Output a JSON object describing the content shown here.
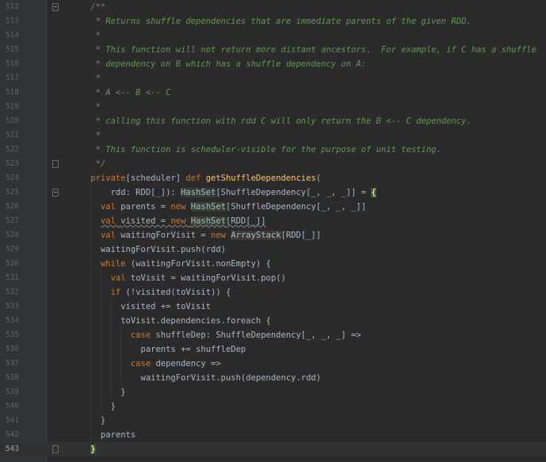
{
  "editor": {
    "lines": [
      {
        "num": "512",
        "fold": "open",
        "tokens": [
          {
            "t": "    /**",
            "c": "comment"
          }
        ]
      },
      {
        "num": "513",
        "tokens": [
          {
            "t": "     * Returns shuffle dependencies that are immediate parents of the given RDD.",
            "c": "comment"
          }
        ]
      },
      {
        "num": "514",
        "tokens": [
          {
            "t": "     *",
            "c": "comment"
          }
        ]
      },
      {
        "num": "515",
        "tokens": [
          {
            "t": "     * This function will not return more distant ancestors.  For example, if C has a shuffle",
            "c": "comment"
          }
        ]
      },
      {
        "num": "516",
        "tokens": [
          {
            "t": "     * dependency on B which has a shuffle dependency on A:",
            "c": "comment"
          }
        ]
      },
      {
        "num": "517",
        "tokens": [
          {
            "t": "     *",
            "c": "comment"
          }
        ]
      },
      {
        "num": "518",
        "tokens": [
          {
            "t": "     * A <-- B <-- C",
            "c": "comment"
          }
        ]
      },
      {
        "num": "519",
        "tokens": [
          {
            "t": "     *",
            "c": "comment"
          }
        ]
      },
      {
        "num": "520",
        "tokens": [
          {
            "t": "     * calling this function with rdd C will only return the B <-- C dependency.",
            "c": "comment"
          }
        ]
      },
      {
        "num": "521",
        "tokens": [
          {
            "t": "     *",
            "c": "comment"
          }
        ]
      },
      {
        "num": "522",
        "tokens": [
          {
            "t": "     * This function is scheduler-visible for the purpose of unit testing.",
            "c": "comment"
          }
        ]
      },
      {
        "num": "523",
        "fold": "close",
        "tokens": [
          {
            "t": "     */",
            "c": "comment"
          }
        ]
      },
      {
        "num": "524",
        "tokens": [
          {
            "t": "    private",
            "c": "kw"
          },
          {
            "t": "[scheduler] "
          },
          {
            "t": "def ",
            "c": "kw"
          },
          {
            "t": "getShuffleDependencies",
            "c": "def"
          },
          {
            "t": "("
          }
        ]
      },
      {
        "num": "525",
        "fold": "open",
        "tokens": [
          {
            "t": "        rdd: RDD[_]): "
          },
          {
            "t": "HashSet",
            "c": "hl"
          },
          {
            "t": "[ShuffleDependency[_, _, _]] = "
          },
          {
            "t": "{",
            "c": "brace"
          }
        ]
      },
      {
        "num": "526",
        "tokens": [
          {
            "t": "      "
          },
          {
            "t": "val ",
            "c": "kw"
          },
          {
            "t": "parents = "
          },
          {
            "t": "new ",
            "c": "kw"
          },
          {
            "t": "HashSet",
            "c": "hl"
          },
          {
            "t": "[ShuffleDependency[_, _, _]]"
          }
        ]
      },
      {
        "num": "527",
        "tokens": [
          {
            "t": "      "
          },
          {
            "t": "val ",
            "c": "kw uline"
          },
          {
            "t": "visited = ",
            "c": "uline"
          },
          {
            "t": "new ",
            "c": "kw uline"
          },
          {
            "t": "HashSet",
            "c": "hl uline"
          },
          {
            "t": "[RDD[_]]",
            "c": "uline"
          }
        ]
      },
      {
        "num": "528",
        "tokens": [
          {
            "t": "      "
          },
          {
            "t": "val ",
            "c": "kw"
          },
          {
            "t": "waitingForVisit = "
          },
          {
            "t": "new ",
            "c": "kw"
          },
          {
            "t": "ArrayStack",
            "c": "hl2"
          },
          {
            "t": "[RDD[_]]"
          }
        ]
      },
      {
        "num": "529",
        "tokens": [
          {
            "t": "      waitingForVisit.push(rdd)"
          }
        ]
      },
      {
        "num": "530",
        "tokens": [
          {
            "t": "      "
          },
          {
            "t": "while ",
            "c": "kw"
          },
          {
            "t": "(waitingForVisit.nonEmpty) {"
          }
        ]
      },
      {
        "num": "531",
        "tokens": [
          {
            "t": "        "
          },
          {
            "t": "val ",
            "c": "kw"
          },
          {
            "t": "toVisit = waitingForVisit.pop()"
          }
        ]
      },
      {
        "num": "532",
        "tokens": [
          {
            "t": "        "
          },
          {
            "t": "if ",
            "c": "kw"
          },
          {
            "t": "(!visited(toVisit)) {"
          }
        ]
      },
      {
        "num": "533",
        "tokens": [
          {
            "t": "          visited += toVisit"
          }
        ]
      },
      {
        "num": "534",
        "tokens": [
          {
            "t": "          toVisit.dependencies.foreach {"
          }
        ]
      },
      {
        "num": "535",
        "tokens": [
          {
            "t": "            "
          },
          {
            "t": "case ",
            "c": "kw"
          },
          {
            "t": "shuffleDep: ShuffleDependency[_, _, _] =>"
          }
        ]
      },
      {
        "num": "536",
        "tokens": [
          {
            "t": "              parents += shuffleDep"
          }
        ]
      },
      {
        "num": "537",
        "tokens": [
          {
            "t": "            "
          },
          {
            "t": "case ",
            "c": "kw"
          },
          {
            "t": "dependency =>"
          }
        ]
      },
      {
        "num": "538",
        "tokens": [
          {
            "t": "              waitingForVisit.push(dependency.rdd)"
          }
        ]
      },
      {
        "num": "539",
        "tokens": [
          {
            "t": "          }"
          }
        ]
      },
      {
        "num": "540",
        "tokens": [
          {
            "t": "        }"
          }
        ]
      },
      {
        "num": "541",
        "tokens": [
          {
            "t": "      }"
          }
        ]
      },
      {
        "num": "542",
        "tokens": [
          {
            "t": "      parents"
          }
        ]
      },
      {
        "num": "543",
        "current": true,
        "fold": "close",
        "tokens": [
          {
            "t": "    "
          },
          {
            "t": "}",
            "c": "caret"
          }
        ]
      }
    ]
  },
  "colors": {
    "background": "#2b2b2b",
    "gutter": "#313335",
    "comment": "#629755",
    "keyword": "#cc7832",
    "function_def": "#ffc66d",
    "default_text": "#a9b7c6",
    "line_number": "#606366"
  }
}
